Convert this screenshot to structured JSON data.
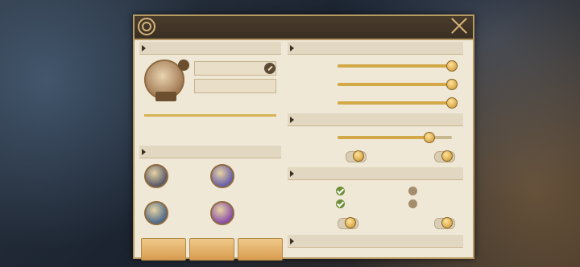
{
  "header": {
    "title": "",
    "subtitle": ""
  },
  "left": {
    "section_profile": "",
    "level": "",
    "avatar_tag": "",
    "player_name": "",
    "guild_status": "",
    "exp_label": "",
    "exp_text": "",
    "exp_progress": 1.0,
    "server_text": "",
    "uid_text": "",
    "location_text": "",
    "section_history": "",
    "history": [
      {
        "label": "",
        "value": "",
        "color": "#5a5a6a"
      },
      {
        "label": "",
        "value": "",
        "color": "#6a5fa8"
      },
      {
        "label": "",
        "value": "",
        "color": "#4f6a8a"
      },
      {
        "label": "",
        "value": "",
        "color": "#8a4fa8"
      }
    ],
    "buttons": [
      "",
      "",
      ""
    ]
  },
  "right": {
    "section_audio": "",
    "music_label": "",
    "sfx_label": "",
    "voice_label": "",
    "music_value": 1.0,
    "sfx_value": 1.0,
    "voice_value": 1.0,
    "section_screen": "",
    "screen_fit_label": "",
    "screen_fit_value": 0.8,
    "shake_label": "",
    "hd_label": "",
    "section_battle": "",
    "op_mode_label": "",
    "op_mode_selected": "",
    "op_mode_other": "",
    "shake_flip_label": "",
    "flip_selected": "",
    "flip_other": "",
    "damage_label": "",
    "must_kill_label": "",
    "section_record": ""
  },
  "colors": {
    "accent": "#d3a947",
    "panel": "#efe8d6",
    "header": "#3a2f24"
  }
}
